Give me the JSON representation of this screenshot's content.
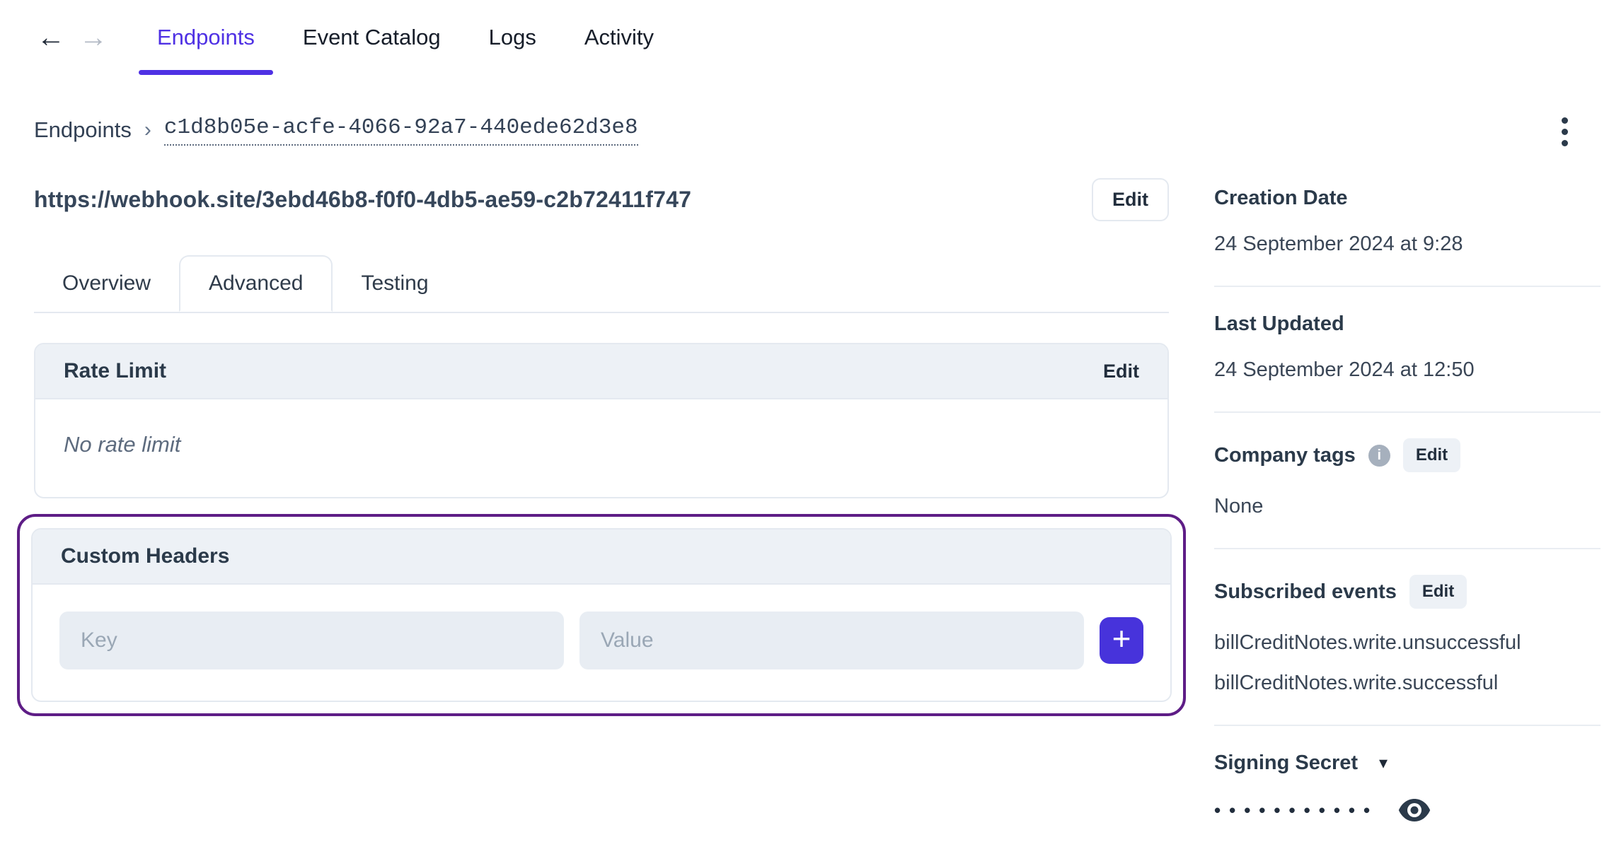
{
  "colors": {
    "accent": "#4F31E4",
    "add_button": "#4733DB",
    "highlight_ring": "#5E1D86",
    "header_bg": "#EDF1F6",
    "input_bg": "#E8EDF3",
    "border": "#E4E9F0",
    "divider": "#E9EDF2",
    "text_primary": "#334155",
    "text_dark": "#222E3D",
    "text_muted": "#5D6B7E",
    "placeholder": "#9AA7B5"
  },
  "icons": {
    "back": "←",
    "forward": "→",
    "breadcrumb_separator": "›",
    "dropdown": "▾",
    "info": "i",
    "add": "+"
  },
  "top_nav": {
    "tabs": [
      {
        "label": "Endpoints",
        "active": true
      },
      {
        "label": "Event Catalog",
        "active": false
      },
      {
        "label": "Logs",
        "active": false
      },
      {
        "label": "Activity",
        "active": false
      }
    ]
  },
  "breadcrumb": {
    "root": "Endpoints",
    "current": "c1d8b05e-acfe-4066-92a7-440ede62d3e8"
  },
  "endpoint_header": {
    "url": "https://webhook.site/3ebd46b8-f0f0-4db5-ae59-c2b72411f747",
    "edit_button": "Edit"
  },
  "detail_tabs": [
    {
      "label": "Overview",
      "active": false
    },
    {
      "label": "Advanced",
      "active": true
    },
    {
      "label": "Testing",
      "active": false
    }
  ],
  "rate_limit_card": {
    "title": "Rate Limit",
    "edit_link": "Edit",
    "empty_message": "No rate limit"
  },
  "custom_headers_card": {
    "title": "Custom Headers",
    "key_placeholder": "Key",
    "value_placeholder": "Value"
  },
  "sidebar": {
    "creation_date": {
      "label": "Creation Date",
      "value": "24 September 2024 at 9:28"
    },
    "last_updated": {
      "label": "Last Updated",
      "value": "24 September 2024 at 12:50"
    },
    "company_tags": {
      "label": "Company tags",
      "edit_button": "Edit",
      "value": "None"
    },
    "subscribed_events": {
      "label": "Subscribed events",
      "edit_button": "Edit",
      "events": [
        "billCreditNotes.write.unsuccessful",
        "billCreditNotes.write.successful"
      ]
    },
    "signing_secret": {
      "label": "Signing Secret",
      "masked_value": "•••••••••••"
    }
  }
}
